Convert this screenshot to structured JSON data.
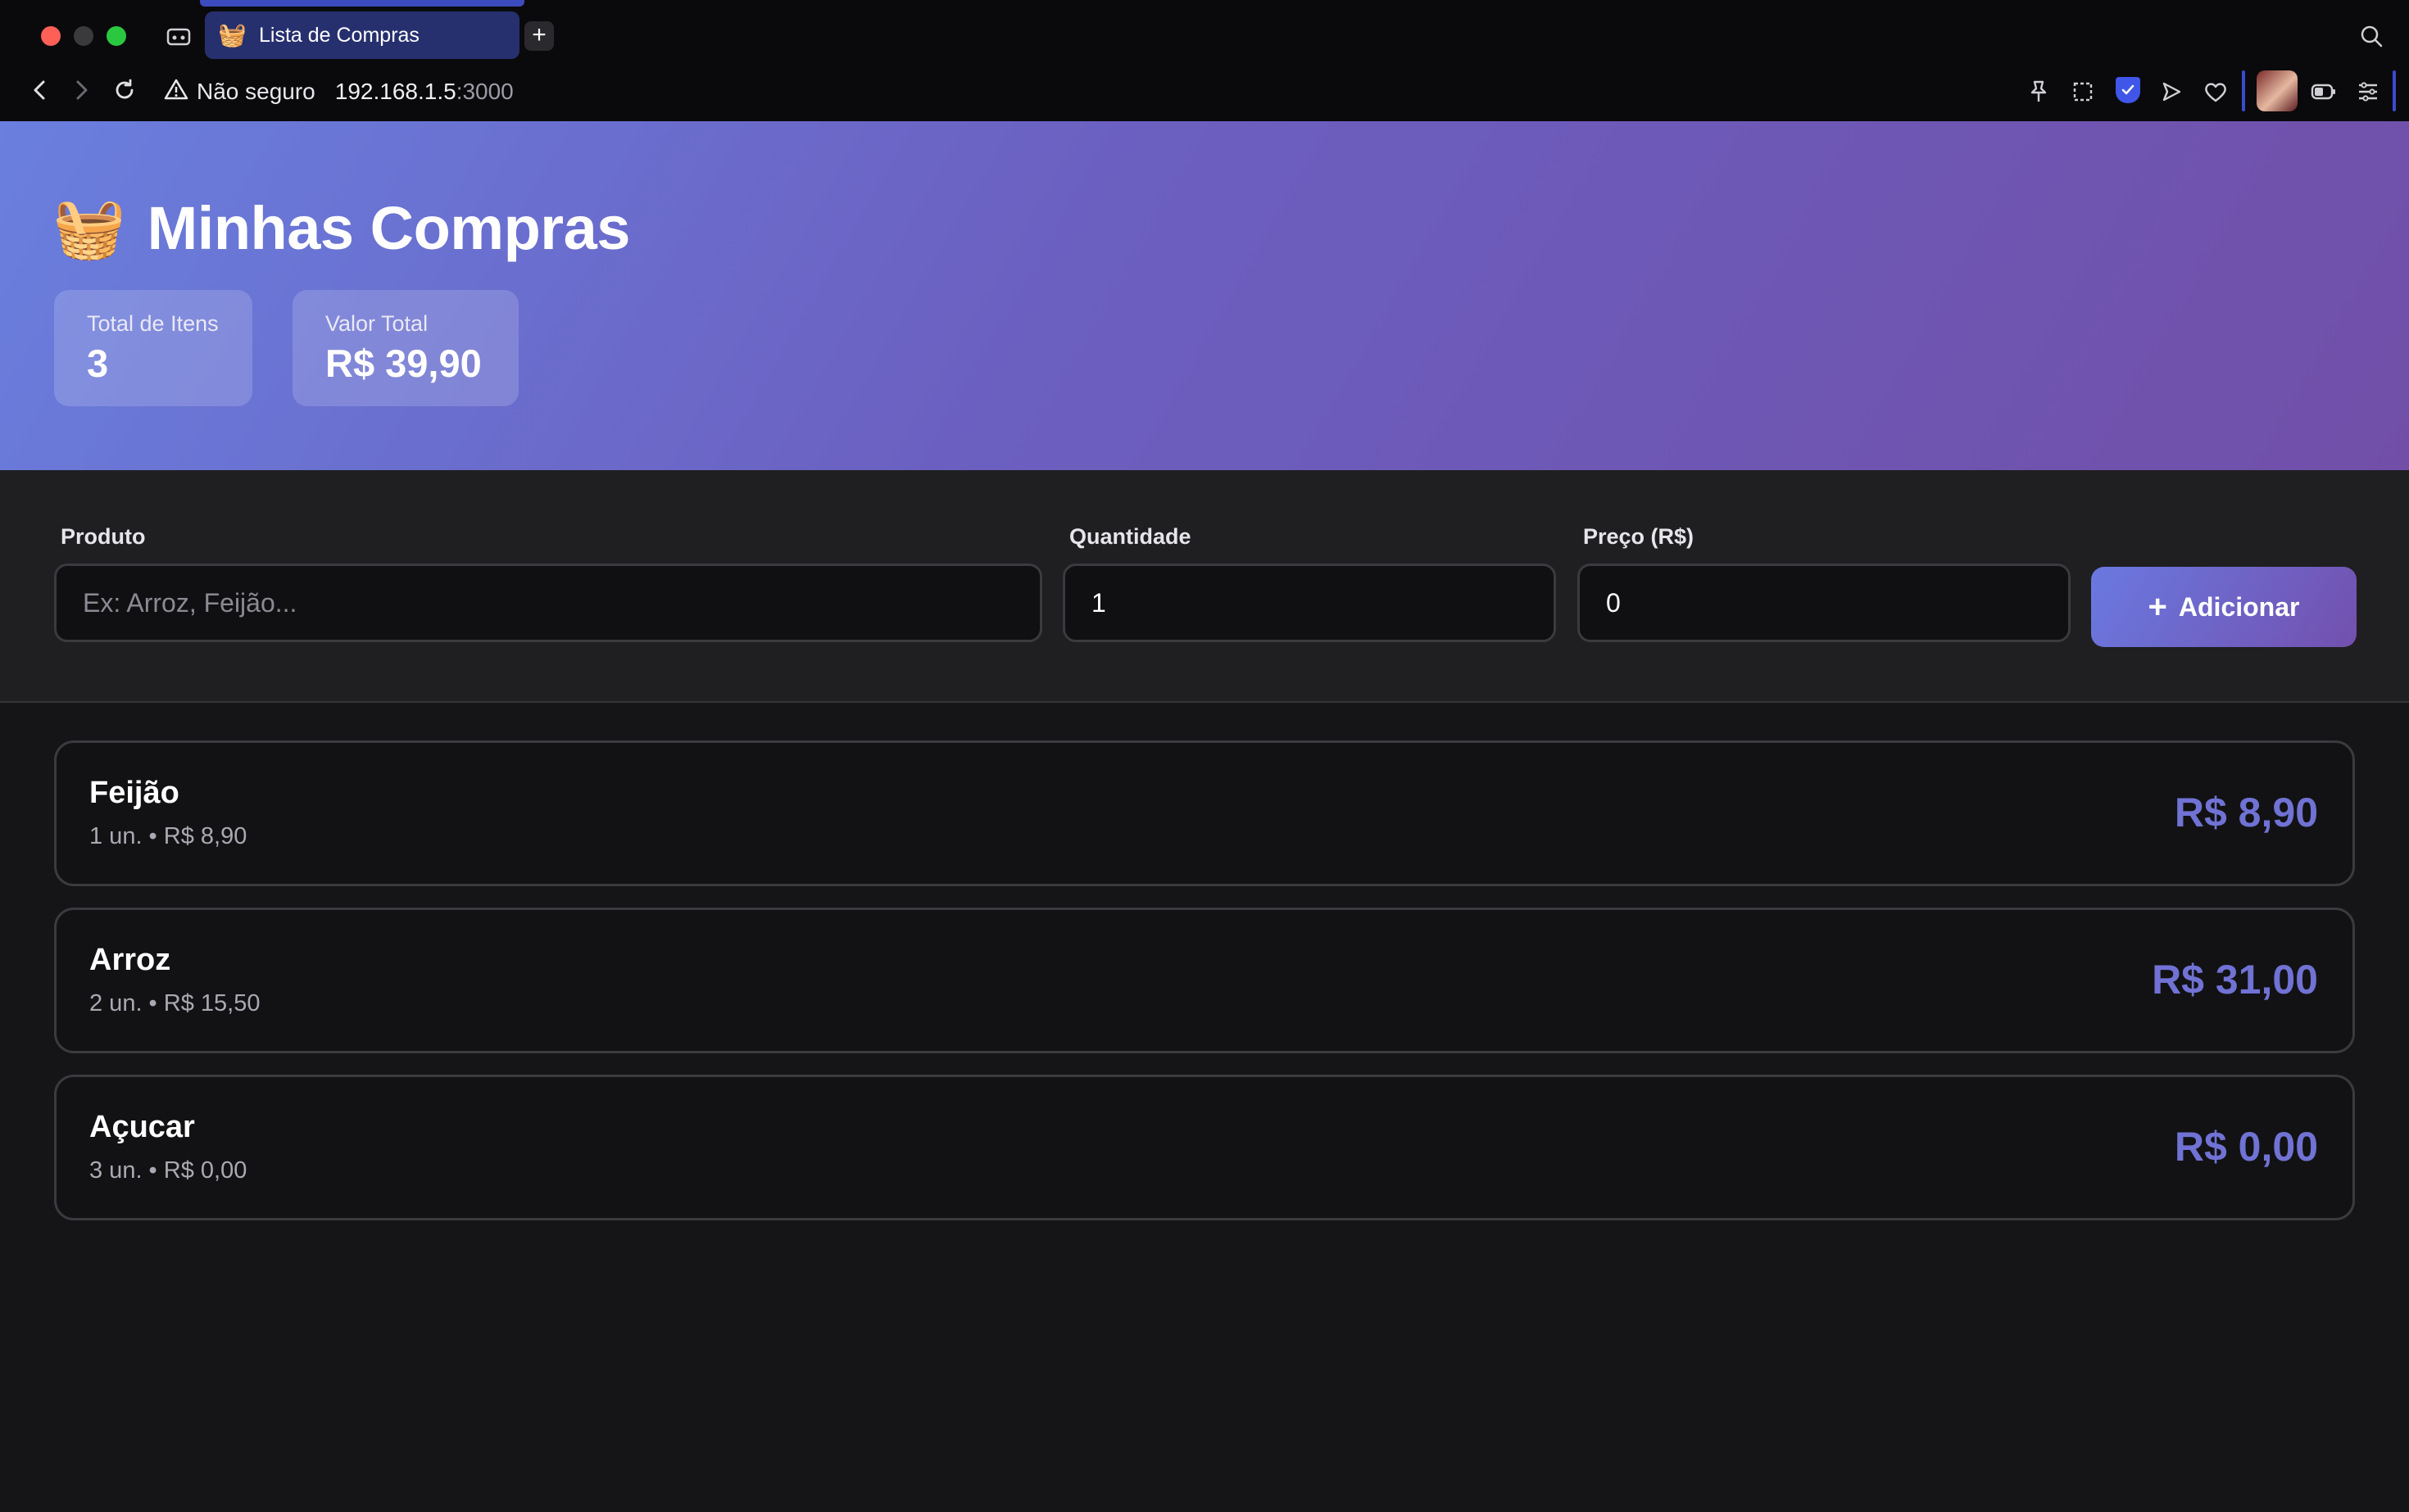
{
  "browser": {
    "tab_title": "Lista de Compras",
    "tab_favicon": "🧺",
    "new_tab_label": "+",
    "security_warning": "Não seguro",
    "url_host": "192.168.1.5",
    "url_port": ":3000"
  },
  "app": {
    "emoji": "🧺",
    "title": "Minhas Compras",
    "stats": {
      "items_label": "Total de Itens",
      "items_value": "3",
      "total_label": "Valor Total",
      "total_value": "R$ 39,90"
    }
  },
  "form": {
    "product_label": "Produto",
    "product_placeholder": "Ex: Arroz, Feijão...",
    "product_value": "",
    "quantity_label": "Quantidade",
    "quantity_value": "1",
    "price_label": "Preço (R$)",
    "price_value": "0",
    "add_button_icon": "+",
    "add_button_label": "Adicionar"
  },
  "items": [
    {
      "name": "Feijão",
      "detail": "1 un. • R$ 8,90",
      "total": "R$ 8,90"
    },
    {
      "name": "Arroz",
      "detail": "2 un. • R$ 15,50",
      "total": "R$ 31,00"
    },
    {
      "name": "Açucar",
      "detail": "3 un. • R$ 0,00",
      "total": "R$ 0,00"
    }
  ],
  "colors": {
    "header_gradient_start": "#6a7fde",
    "header_gradient_end": "#714fa8",
    "accent_price": "#7072d4",
    "tab_active": "#27306e"
  },
  "icons": [
    "back-icon",
    "forward-icon",
    "reload-icon",
    "warning-icon",
    "search-icon",
    "pin-icon",
    "screenshot-icon",
    "bitwarden-shield-icon",
    "send-icon",
    "heart-icon",
    "battery-icon",
    "menu-icon",
    "sidebar-icon"
  ]
}
